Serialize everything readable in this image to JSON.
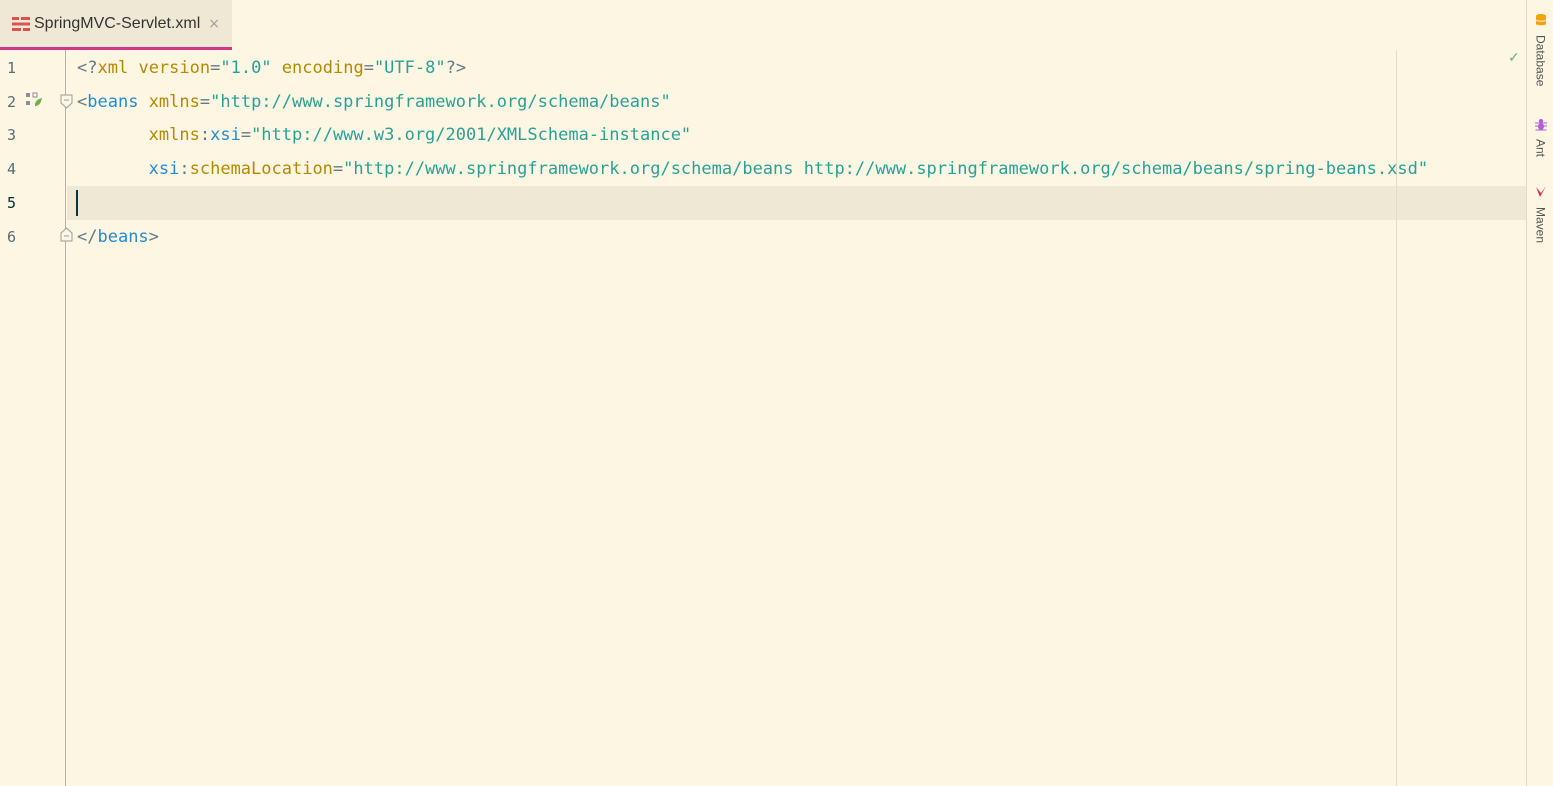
{
  "tab": {
    "label": "SpringMVC-Servlet.xml",
    "close_glyph": "×",
    "icon": "xml-file-icon"
  },
  "gutter": {
    "line_numbers": [
      "1",
      "2",
      "3",
      "4",
      "5",
      "6"
    ],
    "current_line": "5"
  },
  "code": {
    "lines": [
      [
        {
          "t": "<?",
          "c": "tok-bracket"
        },
        {
          "t": "xml",
          "c": "tok-attr"
        },
        {
          "t": " ",
          "c": "tok-bracket"
        },
        {
          "t": "version",
          "c": "tok-attr"
        },
        {
          "t": "=",
          "c": "tok-bracket"
        },
        {
          "t": "\"1.0\"",
          "c": "tok-str"
        },
        {
          "t": " ",
          "c": "tok-bracket"
        },
        {
          "t": "encoding",
          "c": "tok-attr"
        },
        {
          "t": "=",
          "c": "tok-bracket"
        },
        {
          "t": "\"UTF-8\"",
          "c": "tok-str"
        },
        {
          "t": "?>",
          "c": "tok-bracket"
        }
      ],
      [
        {
          "t": "<",
          "c": "tok-bracket"
        },
        {
          "t": "beans",
          "c": "tok-tag"
        },
        {
          "t": " ",
          "c": "tok-bracket"
        },
        {
          "t": "xmlns",
          "c": "tok-attr"
        },
        {
          "t": "=",
          "c": "tok-bracket"
        },
        {
          "t": "\"http://www.springframework.org/schema/beans\"",
          "c": "tok-str"
        }
      ],
      [
        {
          "t": "       ",
          "c": "tok-bracket"
        },
        {
          "t": "xmlns",
          "c": "tok-attr"
        },
        {
          "t": ":",
          "c": "tok-bracket"
        },
        {
          "t": "xsi",
          "c": "tok-ns"
        },
        {
          "t": "=",
          "c": "tok-bracket"
        },
        {
          "t": "\"http://www.w3.org/2001/XMLSchema-instance\"",
          "c": "tok-str"
        }
      ],
      [
        {
          "t": "       ",
          "c": "tok-bracket"
        },
        {
          "t": "xsi",
          "c": "tok-ns"
        },
        {
          "t": ":",
          "c": "tok-bracket"
        },
        {
          "t": "schemaLocation",
          "c": "tok-attr"
        },
        {
          "t": "=",
          "c": "tok-bracket"
        },
        {
          "t": "\"http://www.springframework.org/schema/beans http://www.springframework.org/schema/beans/spring-beans.xsd\"",
          "c": "tok-str"
        }
      ],
      [],
      [
        {
          "t": "</",
          "c": "tok-bracket"
        },
        {
          "t": "beans",
          "c": "tok-tag"
        },
        {
          "t": ">",
          "c": "tok-bracket"
        }
      ]
    ]
  },
  "right_toolbar": {
    "items": [
      {
        "label": "Database",
        "icon": "database-icon"
      },
      {
        "label": "Ant",
        "icon": "ant-icon"
      },
      {
        "label": "Maven",
        "icon": "maven-icon"
      }
    ],
    "inspection_icon": "checkmark-icon"
  },
  "colors": {
    "background": "#fdf6e3",
    "current_line": "#eee8d5",
    "tab_underline": "#d33682",
    "tag": "#268bd2",
    "attribute": "#b58900",
    "string": "#2aa198"
  }
}
